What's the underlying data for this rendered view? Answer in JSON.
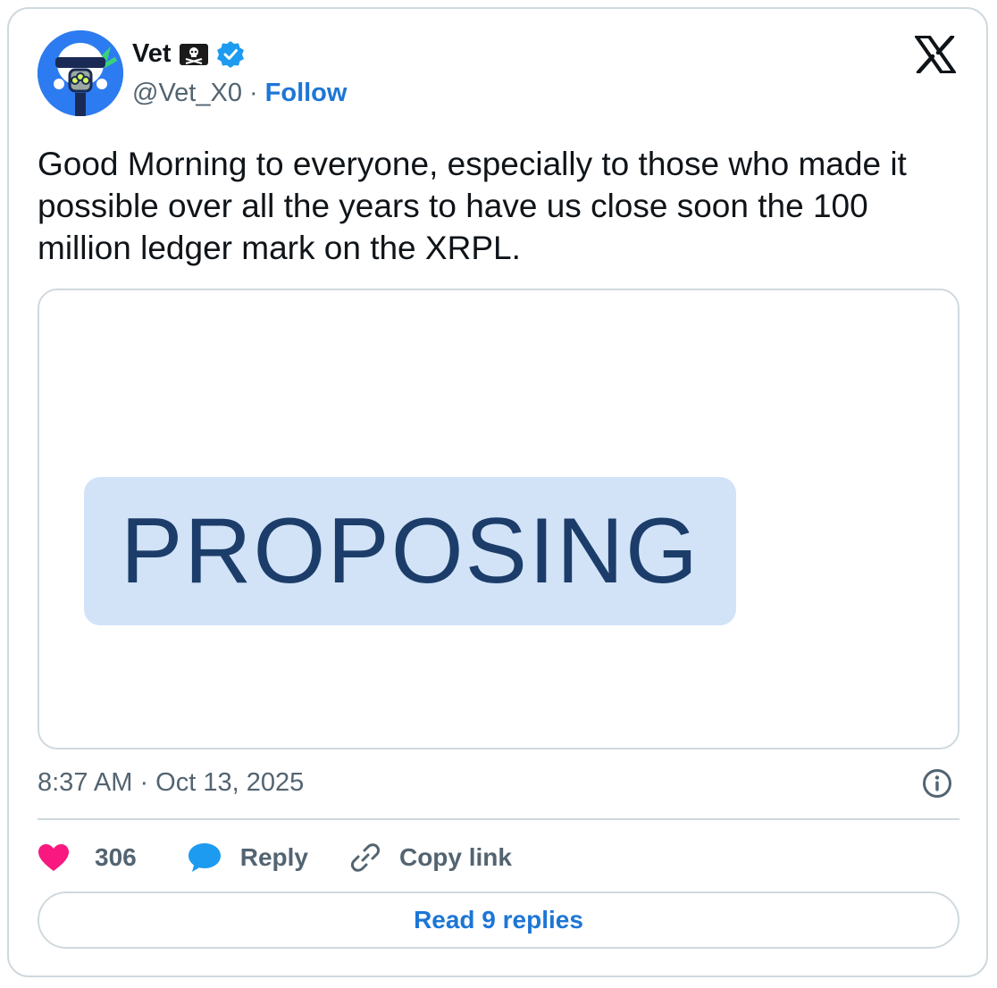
{
  "author": {
    "name": "Vet",
    "handle": "@Vet_X0",
    "separator": "·",
    "follow_label": "Follow",
    "avatar_icon": "astronaut-avatar-icon",
    "badge_icon": "pirate-flag-icon",
    "verified_icon": "verified-badge-icon"
  },
  "platform_icon": "x-logo-icon",
  "tweet": {
    "text": "Good Morning to everyone, especially to those who made it possible over all the years to have us close soon the 100 million ledger mark on the XRPL."
  },
  "media": {
    "badge_text": "PROPOSING",
    "badge_bg": "#d2e3f8",
    "badge_fg": "#1c3d6a"
  },
  "meta": {
    "timestamp": "8:37 AM · Oct 13, 2025",
    "info_icon": "info-icon"
  },
  "actions": {
    "like_count": "306",
    "like_icon": "heart-icon",
    "reply_label": "Reply",
    "reply_icon": "speech-bubble-icon",
    "copy_label": "Copy link",
    "copy_icon": "link-icon"
  },
  "read_replies_label": "Read 9 replies",
  "colors": {
    "accent": "#1d76d6",
    "like": "#f91880",
    "reply": "#1d9bf0",
    "verified": "#1d9bf0",
    "text_secondary": "#536471"
  }
}
